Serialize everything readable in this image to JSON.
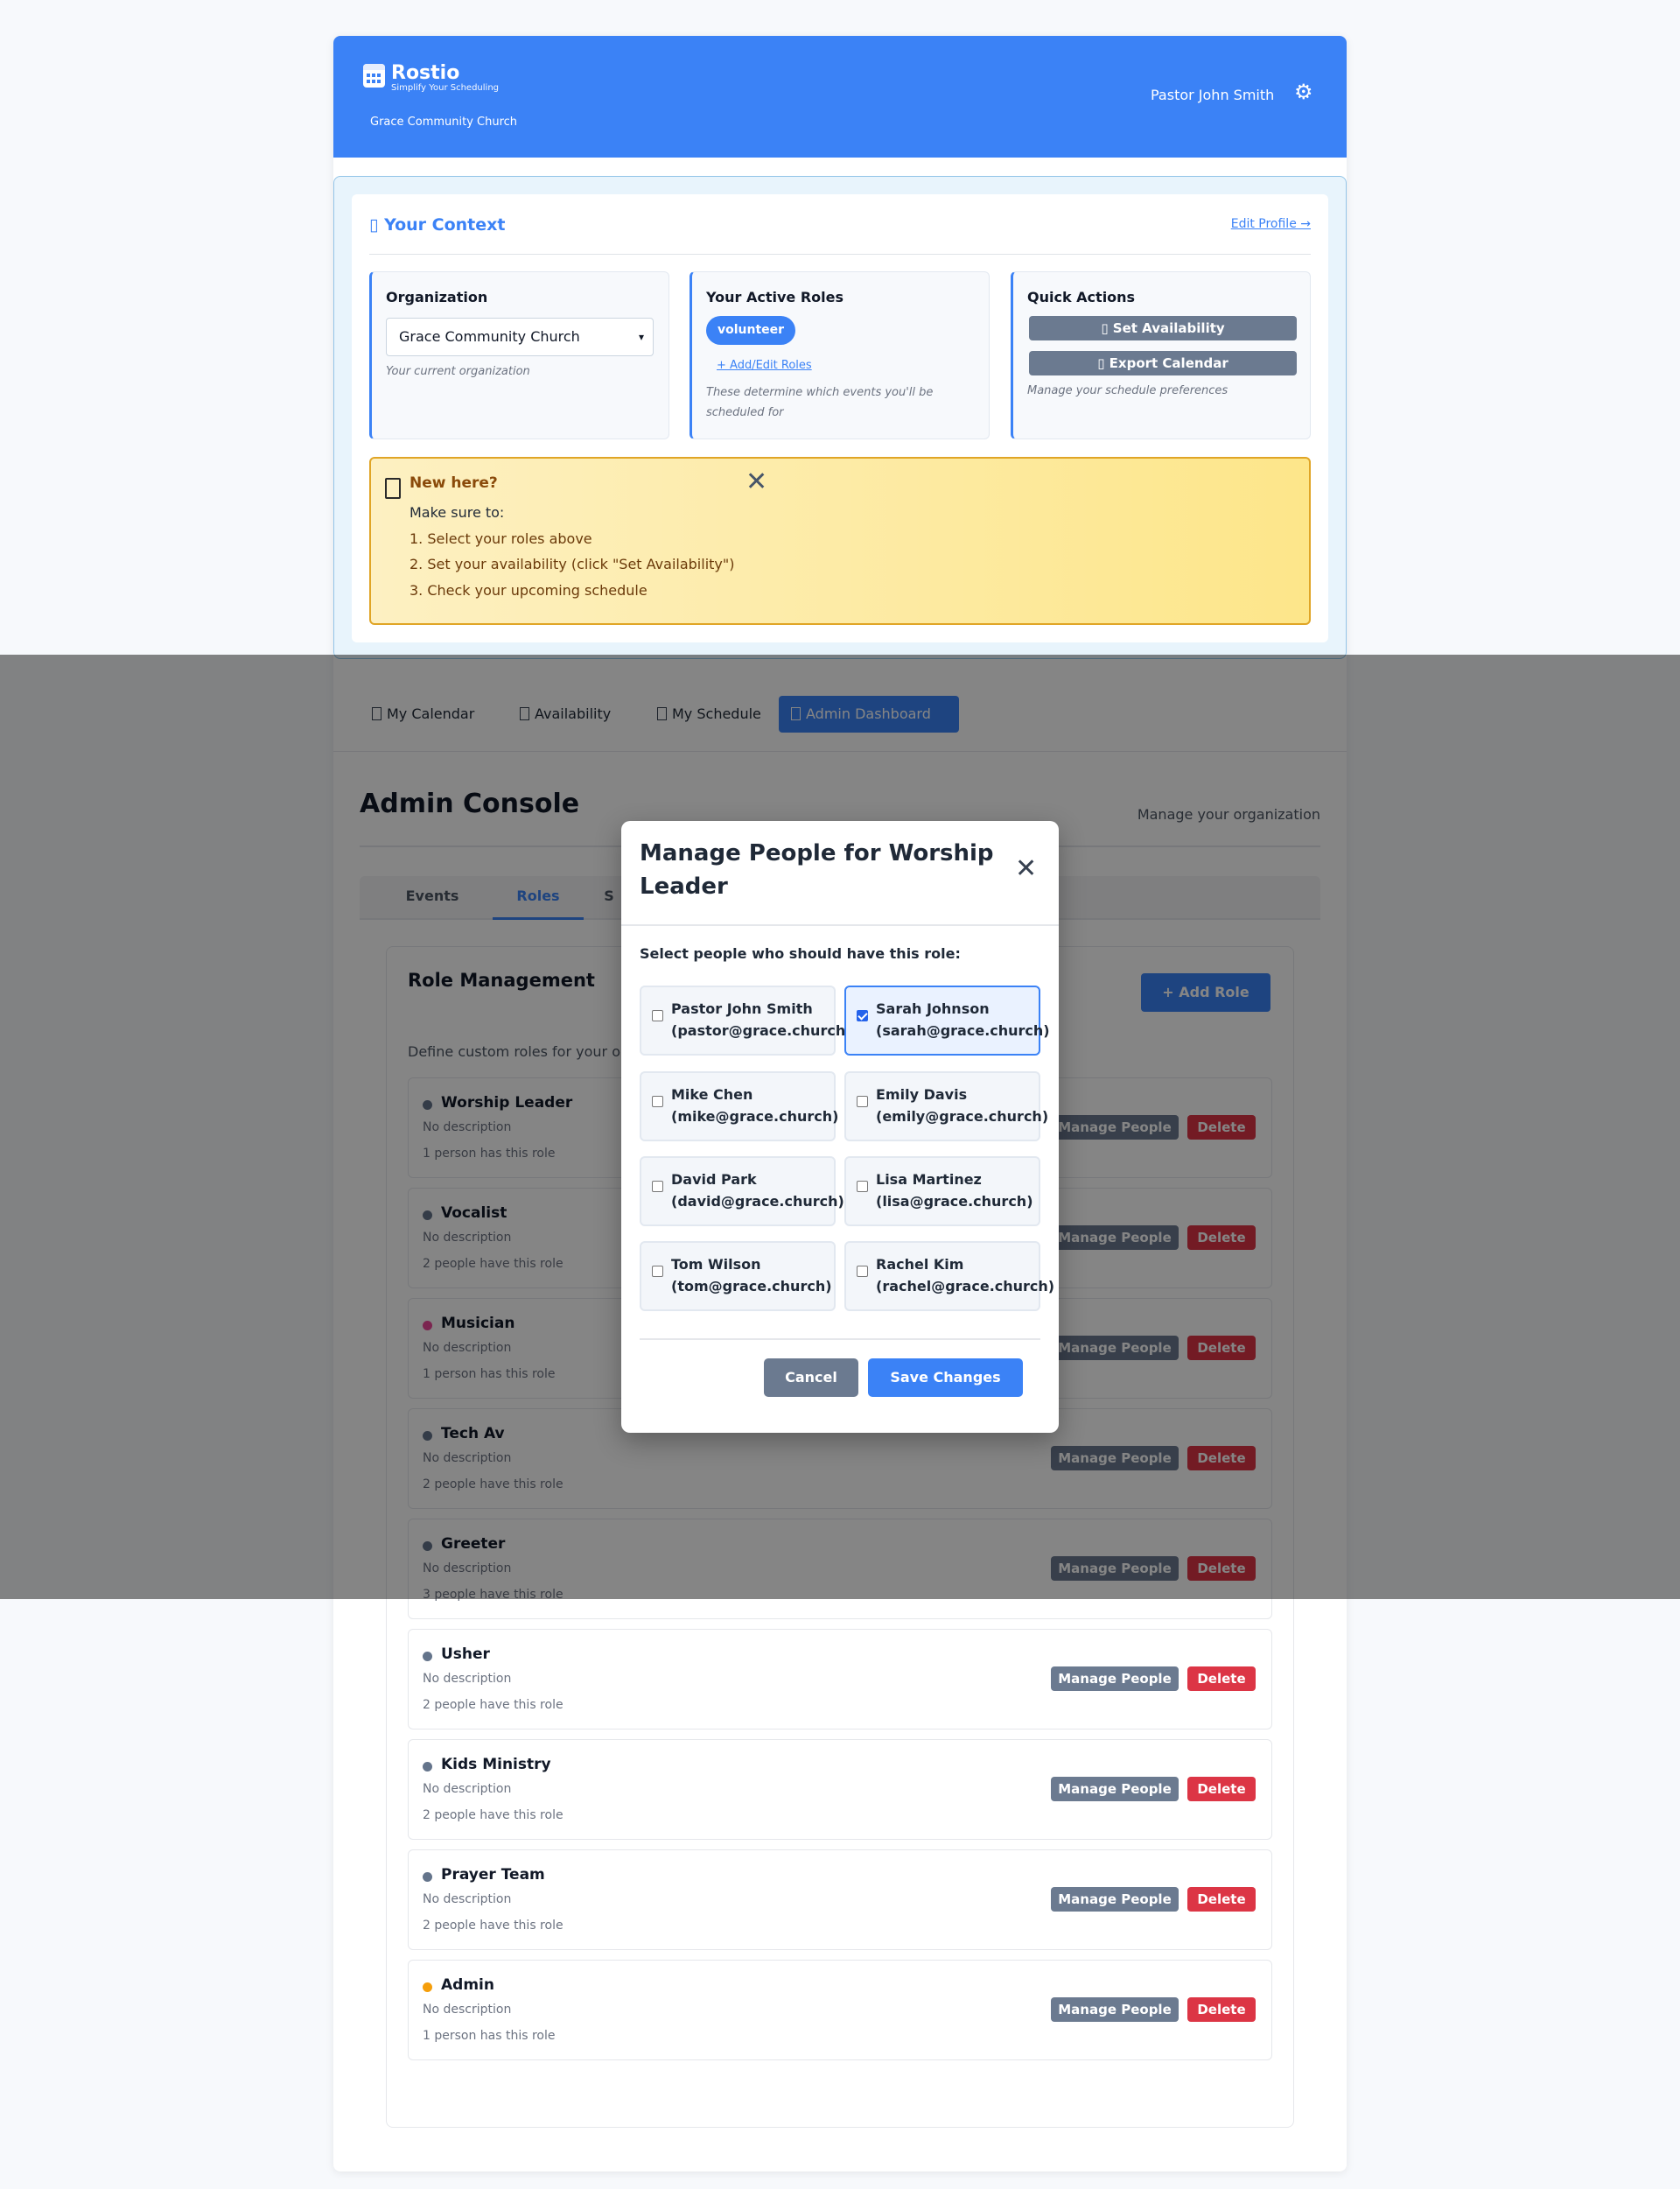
{
  "header": {
    "brand": "Rostio",
    "tagline": "Simplify Your Scheduling",
    "org_name": "Grace Community Church",
    "user_name": "Pastor John Smith",
    "settings_icon": "⚙",
    "accent_color": "#3b82f6"
  },
  "context": {
    "title": "▯ Your Context",
    "edit_profile": "Edit Profile →",
    "organization": {
      "title": "Organization",
      "selected": "Grace Community Church",
      "note": "Your current organization"
    },
    "roles": {
      "title": "Your Active Roles",
      "pill": "volunteer",
      "link": "+ Add/Edit Roles",
      "note": "These determine which events you'll be scheduled for"
    },
    "quick_actions": {
      "title": "Quick Actions",
      "set_availability": "▯ Set Availability",
      "export_calendar": "▯ Export Calendar",
      "note": "Manage your schedule preferences"
    }
  },
  "welcome": {
    "title": "New here?",
    "intro": "Make sure to:",
    "steps": [
      "1. Select your roles above",
      "2. Set your availability (click \"Set Availability\")",
      "3. Check your upcoming schedule"
    ],
    "close": "✕"
  },
  "nav": {
    "tabs": [
      {
        "label": "My Calendar"
      },
      {
        "label": "Availability"
      },
      {
        "label": "My Schedule"
      },
      {
        "label": "Admin Dashboard",
        "active": true
      }
    ]
  },
  "admin": {
    "title": "Admin Console",
    "subtitle": "Manage your organization",
    "subtabs": [
      {
        "label": "Events"
      },
      {
        "label": "Roles",
        "active": true
      },
      {
        "label": "S"
      }
    ]
  },
  "role_management": {
    "title": "Role Management",
    "add_button": "+ Add Role",
    "description": "Define custom roles for your o",
    "manage_label": "Manage People",
    "delete_label": "Delete",
    "roles": [
      {
        "name": "Worship Leader",
        "description": "No description",
        "count": "1 person has this role",
        "color": "#64748b"
      },
      {
        "name": "Vocalist",
        "description": "No description",
        "count": "2 people have this role",
        "color": "#64748b"
      },
      {
        "name": "Musician",
        "description": "No description",
        "count": "1 person has this role",
        "color": "#ec4899"
      },
      {
        "name": "Tech Av",
        "description": "No description",
        "count": "2 people have this role",
        "color": "#64748b"
      },
      {
        "name": "Greeter",
        "description": "No description",
        "count": "3 people have this role",
        "color": "#64748b"
      },
      {
        "name": "Usher",
        "description": "No description",
        "count": "2 people have this role",
        "color": "#64748b"
      },
      {
        "name": "Kids Ministry",
        "description": "No description",
        "count": "2 people have this role",
        "color": "#64748b"
      },
      {
        "name": "Prayer Team",
        "description": "No description",
        "count": "2 people have this role",
        "color": "#64748b"
      },
      {
        "name": "Admin",
        "description": "No description",
        "count": "1 person has this role",
        "color": "#f59e0b"
      }
    ]
  },
  "modal": {
    "title": "Manage People for Worship Leader",
    "close": "✕",
    "prompt": "Select people who should have this role:",
    "people": [
      {
        "name": "Pastor John Smith",
        "email": "(pastor@grace.church)",
        "checked": false
      },
      {
        "name": "Sarah Johnson",
        "email": "(sarah@grace.church)",
        "checked": true
      },
      {
        "name": "Mike Chen",
        "email": "(mike@grace.church)",
        "checked": false
      },
      {
        "name": "Emily Davis",
        "email": "(emily@grace.church)",
        "checked": false
      },
      {
        "name": "David Park",
        "email": "(david@grace.church)",
        "checked": false
      },
      {
        "name": "Lisa Martinez",
        "email": "(lisa@grace.church)",
        "checked": false
      },
      {
        "name": "Tom Wilson",
        "email": "(tom@grace.church)",
        "checked": false
      },
      {
        "name": "Rachel Kim",
        "email": "(rachel@grace.church)",
        "checked": false
      }
    ],
    "cancel": "Cancel",
    "save": "Save Changes"
  }
}
